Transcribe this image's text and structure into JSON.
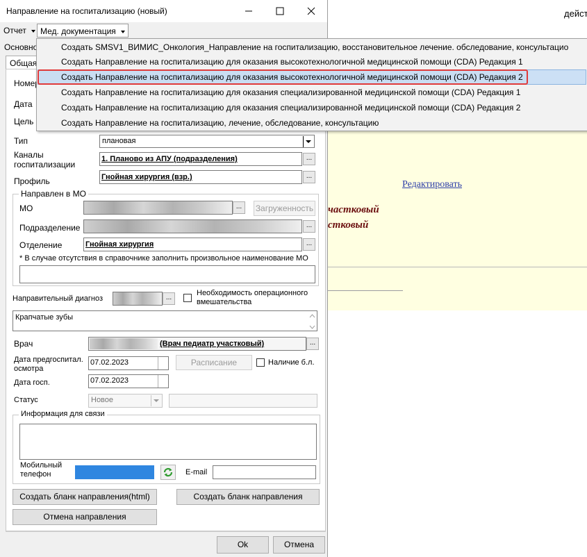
{
  "window": {
    "title": "Направление на госпитализацию (новый)"
  },
  "background": {
    "action_text": "дейст",
    "edit_link": "Редактировать",
    "role_line1": "частковый",
    "role_line2": "стковый"
  },
  "menu": {
    "report": "Отчет",
    "med_docs": "Мед. документация"
  },
  "dropdown": {
    "items": [
      "Создать SMSV1_ВИМИС_Онкология_Направление на госпитализацию, восстановительное лечение. обследование, консультацио",
      "Создать Направление на госпитализацию для оказания высокотехнологичной медицинской помощи (CDA) Редакция 1",
      "Создать Направление на госпитализацию для оказания высокотехнологичной медицинской помощи (CDA) Редакция 2",
      "Создать Направление на госпитализацию для оказания специализированной медицинской помощи (CDA) Редакция 1",
      "Создать Направление на госпитализацию для оказания специализированной медицинской помощи (CDA) Редакция 2",
      "Создать Направление на госпитализацию, лечение, обследование, консультацию"
    ],
    "selected_index": 2
  },
  "tabs": {
    "main_partial": "Основно",
    "sub_partial": "Общая"
  },
  "form": {
    "number_label": "Номер",
    "date_label": "Дата",
    "goal_label": "Цель",
    "type_label": "Тип",
    "type_value": "плановая",
    "channels_label_1": "Каналы",
    "channels_label_2": "госпитализации",
    "channels_value": "1. Планово из АПУ (подразделения)",
    "profile_label": "Профиль",
    "profile_value": "Гнойная хирургия (взр.)",
    "directed_group": "Направлен в МО",
    "mo_label": "МО",
    "loaded_button": "Загруженность",
    "subdivision_label": "Подразделение",
    "department_label": "Отделение",
    "department_value": "Гнойная хирургия",
    "mo_note": "* В случае отсутствия в справочнике заполнить произвольное наименование МО",
    "diagnosis_label": "Направительный диагноз",
    "surgery_label_1": "Необходимость  операционного",
    "surgery_label_2": "вмешательства",
    "diagnosis_text": "Крапчатые зубы",
    "doctor_label": "Врач",
    "doctor_value": "(Врач педиатр участковый)",
    "pre_exam_label_1": "Дата предгоспитал.",
    "pre_exam_label_2": "осмотра",
    "pre_exam_value": "07.02.2023",
    "schedule_button": "Расписание",
    "sick_leave_label": "Наличие б.л.",
    "hosp_date_label": "Дата госп.",
    "hosp_date_value": "07.02.2023",
    "status_label": "Статус",
    "status_value": "Новое",
    "contact_group": "Информация для связи",
    "mobile_label_1": "Мобильный",
    "mobile_label_2": "телефон",
    "email_label": "E-mail"
  },
  "buttons": {
    "create_html": "Создать бланк направления(html)",
    "create_form": "Создать бланк направления",
    "cancel_direction": "Отмена направления",
    "ok": "Ok",
    "cancel": "Отмена"
  },
  "colors": {
    "highlight_border": "#e03a3a",
    "highlight_fill": "#cce0f5",
    "link": "#2d3ea8",
    "role_text": "#6b0f0f",
    "phone_field": "#2f86e0",
    "yellow_panel": "#ffffe1"
  }
}
